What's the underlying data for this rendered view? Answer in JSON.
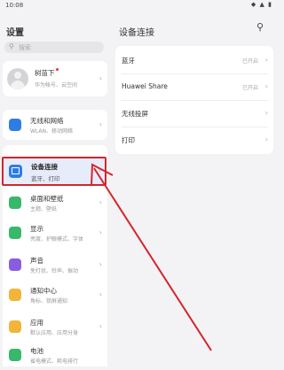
{
  "status_bar": {
    "time": "10:08",
    "icons": "◆ ▲ ▮"
  },
  "left": {
    "title": "设置",
    "search_placeholder": "搜索",
    "profile": {
      "name": "树苗下",
      "subtitle": "华为帐号、云空间"
    },
    "items": [
      {
        "label": "无线和网络",
        "sub": "WLAN、移动网络",
        "color": "#2f7ce5",
        "icon": "wifi-icon"
      },
      {
        "label": "设备连接",
        "sub": "蓝牙、打印",
        "color": "#2f7ce5",
        "icon": "device-link-icon"
      },
      {
        "label": "桌面和壁纸",
        "sub": "主题、壁纸",
        "color": "#37b86a",
        "icon": "wallpaper-icon"
      },
      {
        "label": "显示",
        "sub": "亮度、护眼模式、字体",
        "color": "#37b86a",
        "icon": "display-icon"
      },
      {
        "label": "声音",
        "sub": "免打扰、铃声、振动",
        "color": "#8a5ce0",
        "icon": "sound-icon"
      },
      {
        "label": "通知中心",
        "sub": "角标、锁屏通知",
        "color": "#f2b53a",
        "icon": "notification-icon"
      },
      {
        "label": "应用",
        "sub": "默认应用、应用分身",
        "color": "#f2b53a",
        "icon": "apps-icon"
      },
      {
        "label": "电池",
        "sub": "省电模式、耗电排行",
        "color": "#37b86a",
        "icon": "battery-icon"
      }
    ]
  },
  "right": {
    "title": "设备连接",
    "items": [
      {
        "label": "蓝牙",
        "value": "已开启"
      },
      {
        "label": "Huawei Share",
        "value": "已开启"
      },
      {
        "label": "无线投屏",
        "value": ""
      },
      {
        "label": "打印",
        "value": ""
      }
    ]
  }
}
